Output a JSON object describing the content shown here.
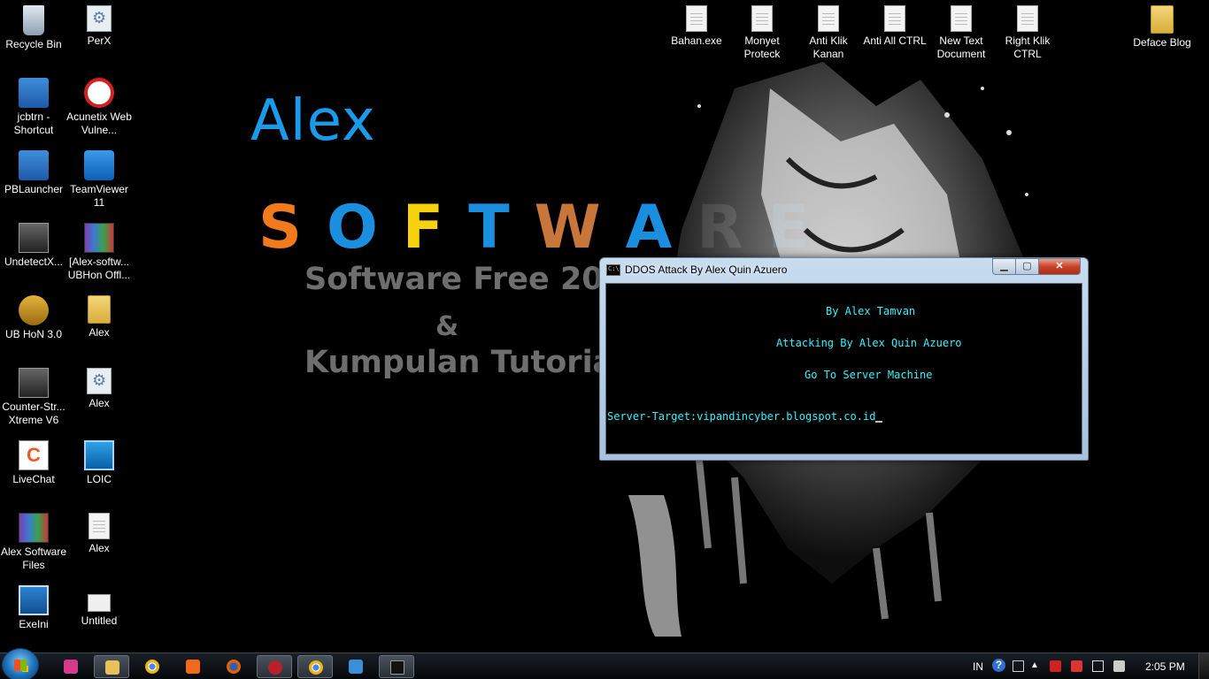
{
  "wallpaper": {
    "alex": "Alex",
    "software_letters": [
      "S",
      "O",
      "F",
      "T",
      "W",
      "A",
      "R",
      "E"
    ],
    "software_colors": [
      "#f07a1c",
      "#1a8fe0",
      "#f5d20c",
      "#1a8fe0",
      "#c8763a",
      "#1a8fe0",
      "#888888",
      "#1a8fe0"
    ],
    "line1": "Software Free 2016",
    "amp": "&",
    "line3": "Kumpulan Tutorial"
  },
  "desktop_icons": [
    {
      "label": "Recycle Bin",
      "icon": "recycle-bin-icon"
    },
    {
      "label": "PerX",
      "icon": "settings-file-icon"
    },
    {
      "label": "jcbtrn - Shortcut",
      "icon": "shortcut-icon"
    },
    {
      "label": "Acunetix Web Vulne...",
      "icon": "acunetix-icon"
    },
    {
      "label": "PBLauncher",
      "icon": "pblauncher-icon"
    },
    {
      "label": "TeamViewer 11",
      "icon": "teamviewer-icon"
    },
    {
      "label": "UndetectX...",
      "icon": "counter-strike-icon"
    },
    {
      "label": "[Alex-softw... UBHon Offl...",
      "icon": "winrar-icon"
    },
    {
      "label": "UB HoN 3.0",
      "icon": "hon-icon"
    },
    {
      "label": "Alex",
      "icon": "folder-icon"
    },
    {
      "label": "Counter-Str... Xtreme V6",
      "icon": "counter-strike-icon"
    },
    {
      "label": "Alex",
      "icon": "settings-file-icon"
    },
    {
      "label": "LiveChat",
      "icon": "livechat-icon"
    },
    {
      "label": "LOIC",
      "icon": "loic-icon"
    },
    {
      "label": "Alex Software Files",
      "icon": "winrar-icon"
    },
    {
      "label": "Alex",
      "icon": "document-icon"
    },
    {
      "label": "ExeIni",
      "icon": "exeini-icon"
    },
    {
      "label": "Untitled",
      "icon": "untitled-file-icon"
    },
    {
      "label": "Bahan.exe",
      "icon": "document-icon"
    },
    {
      "label": "Monyet Proteck",
      "icon": "document-icon"
    },
    {
      "label": "Anti Klik Kanan",
      "icon": "document-icon"
    },
    {
      "label": "Anti All CTRL",
      "icon": "document-icon"
    },
    {
      "label": "New Text Document",
      "icon": "document-icon"
    },
    {
      "label": "Right Klik CTRL",
      "icon": "document-icon"
    },
    {
      "label": "Deface Blog",
      "icon": "folder-icon"
    }
  ],
  "cmd_window": {
    "title": "DDOS Attack By Alex Quin Azuero",
    "minimize": "▁",
    "maximize": "▢",
    "close": "✕",
    "lines": [
      "By Alex Tamvan",
      "Attacking By Alex Quin Azuero",
      "Go To Server Machine",
      "Server-Target:vipandincyber.blogspot.co.id"
    ],
    "text_color": "#33f3ff"
  },
  "taskbar": {
    "apps": [
      {
        "name": "app-icon",
        "color": "#d63a8a"
      },
      {
        "name": "file-explorer-icon",
        "color": "#e9c15a"
      },
      {
        "name": "chrome-icon",
        "color": "#e8b71a"
      },
      {
        "name": "app-icon",
        "color": "#ef6a1c"
      },
      {
        "name": "firefox-icon",
        "color": "#e66000"
      },
      {
        "name": "bug-icon",
        "color": "#b8202a"
      },
      {
        "name": "chrome-icon",
        "color": "#e8b71a"
      },
      {
        "name": "app-icon",
        "color": "#3a8fd8"
      },
      {
        "name": "command-prompt-icon",
        "color": "#111111"
      }
    ],
    "language": "IN",
    "help": "?",
    "clock": "2:05 PM"
  }
}
